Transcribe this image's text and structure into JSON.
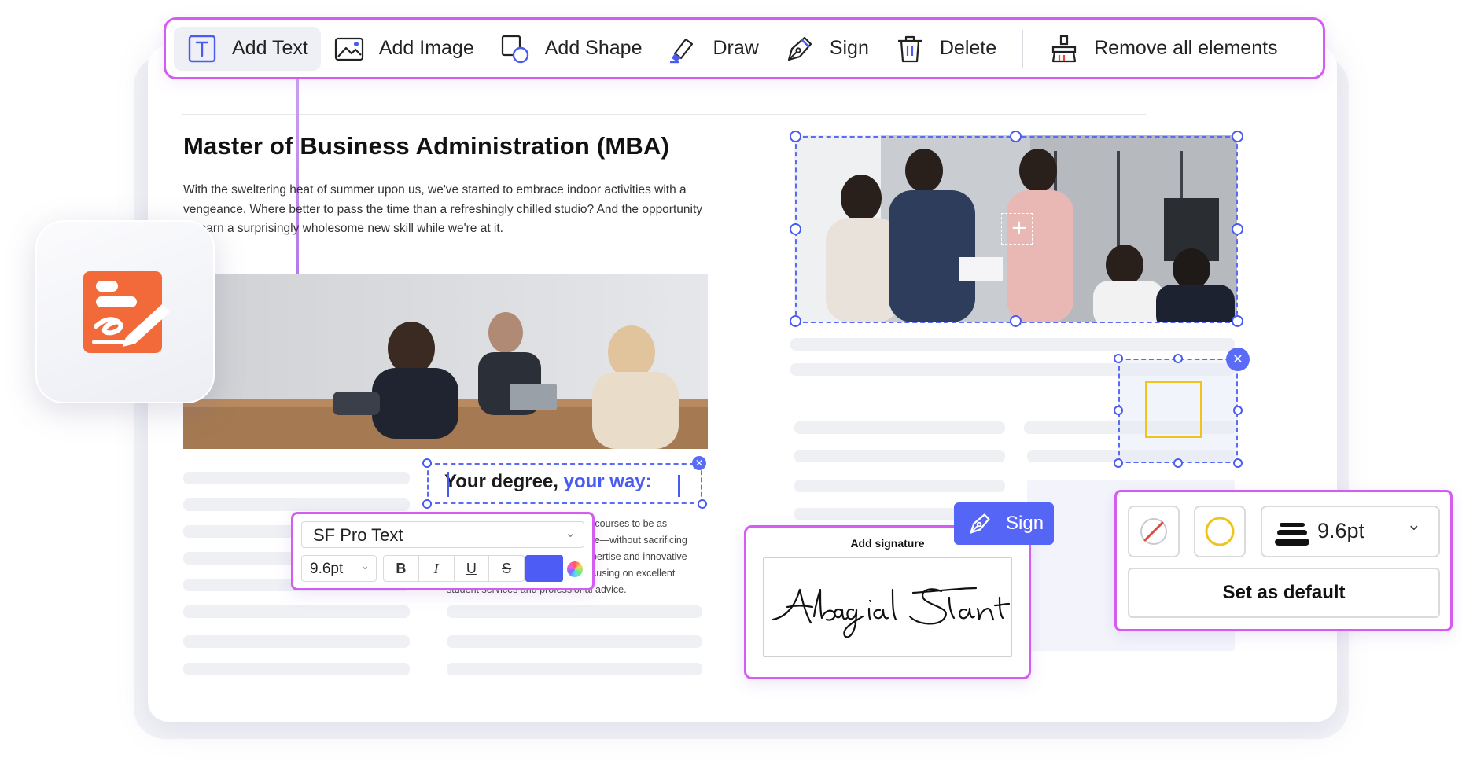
{
  "toolbar": {
    "items": [
      {
        "label": "Add Text",
        "icon": "text-box-icon"
      },
      {
        "label": "Add Image",
        "icon": "image-icon"
      },
      {
        "label": "Add Shape",
        "icon": "shape-icon"
      },
      {
        "label": "Draw",
        "icon": "highlighter-icon"
      },
      {
        "label": "Sign",
        "icon": "pen-nib-icon"
      },
      {
        "label": "Delete",
        "icon": "trash-icon"
      },
      {
        "label": "Remove all elements",
        "icon": "broom-icon"
      }
    ]
  },
  "article": {
    "title": "Master of Business Administration (MBA)",
    "body": "With the sweltering heat of summer upon us, we've started to embrace indoor activities with a vengeance. Where better to pass the time than a refreshingly chilled studio? And the opportunity to learn a surprisingly wholesome new skill while we're at it."
  },
  "text_edit": {
    "text_main": "Your degree, ",
    "text_accent": "your way:",
    "more_lines": [
      "d courses to be as",
      "ble—without sacrificing",
      "pertise and innovative",
      "cusing on excellent",
      "student services and professional advice."
    ]
  },
  "font_panel": {
    "font": "SF Pro Text",
    "size": "9.6pt",
    "bold": "B",
    "italic": "I",
    "underline": "U",
    "strike": "S",
    "color": "#4c5cf5"
  },
  "signature": {
    "label": "Add signature",
    "name": "Abigail Stanton",
    "button": "Sign"
  },
  "style_panel": {
    "stroke": "9.6pt",
    "set_default": "Set as default",
    "fill_color": "none",
    "stroke_color": "#f0c419"
  },
  "colors": {
    "accent": "#5a6cf5",
    "highlight": "#d55cf0",
    "app_icon": "#f26a3a"
  }
}
